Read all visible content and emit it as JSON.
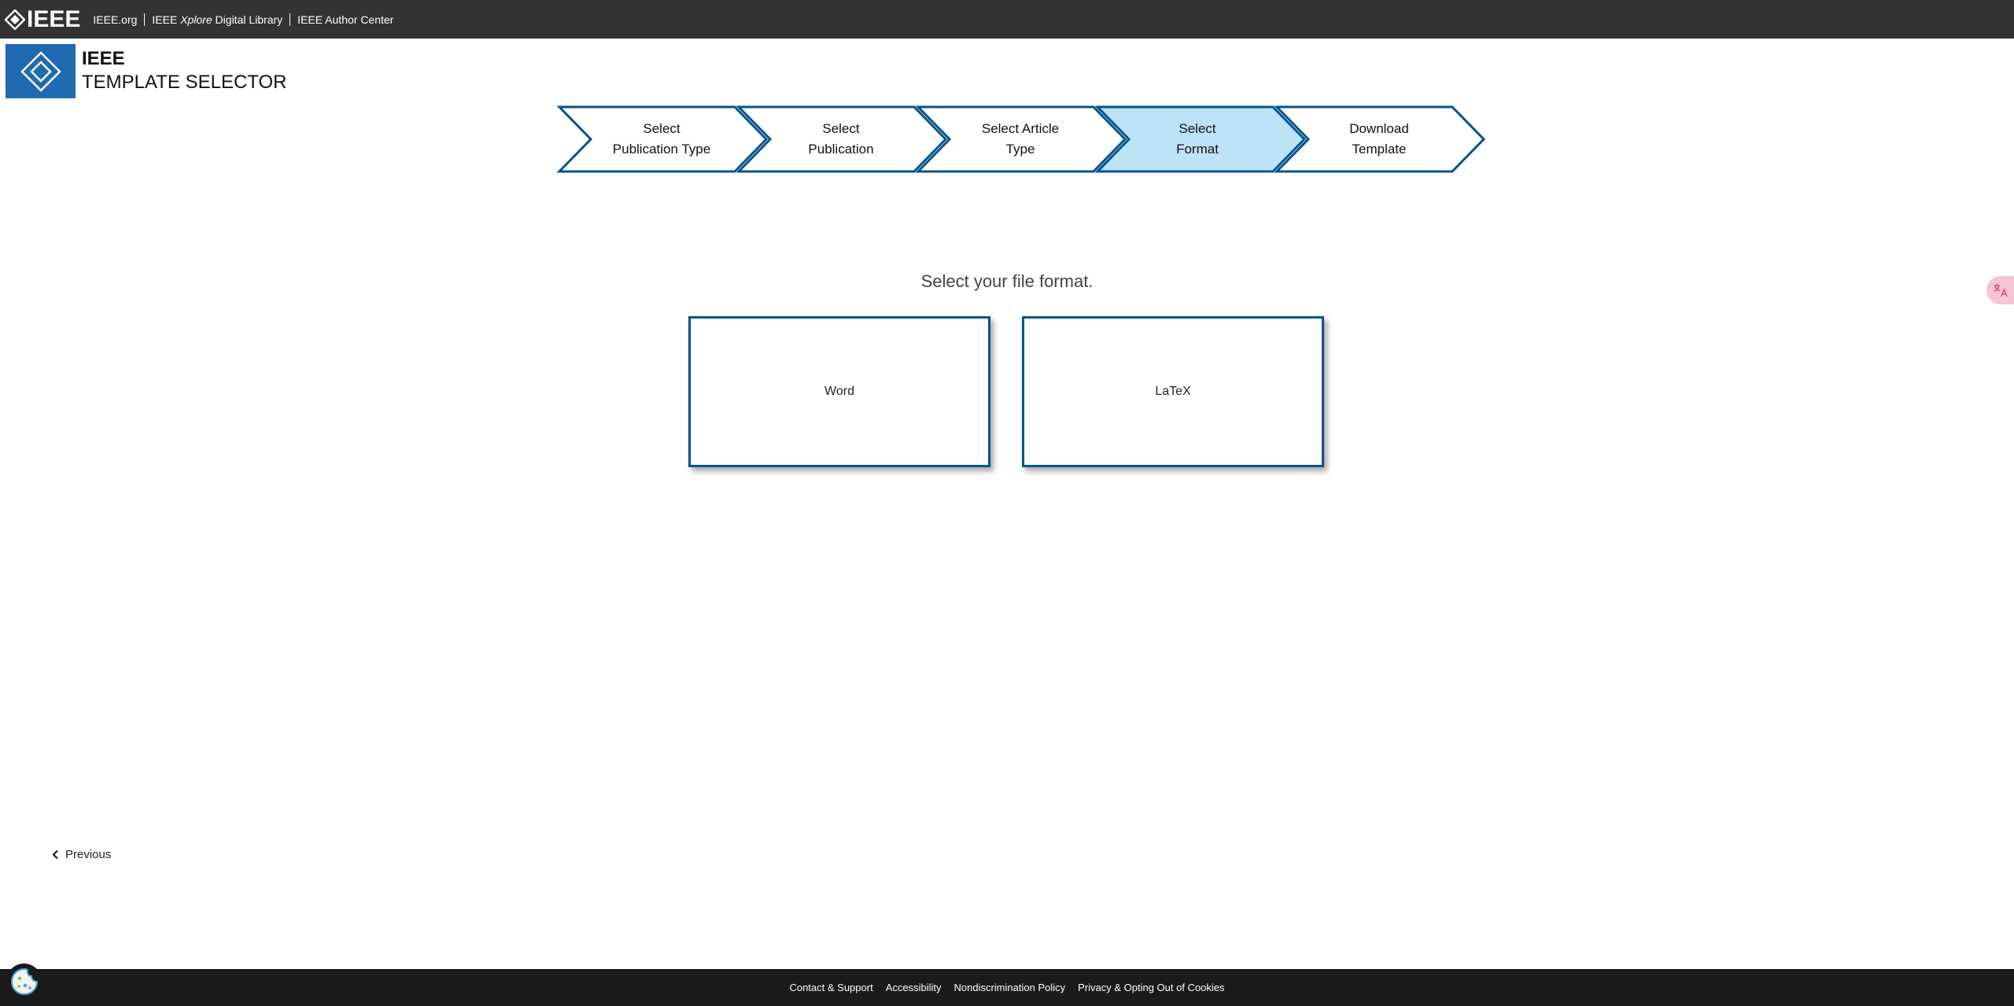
{
  "topbar": {
    "brand": "IEEE",
    "links": [
      {
        "label": "IEEE.org"
      },
      {
        "label_prefix": "IEEE ",
        "label_italic": "Xplore",
        "label_suffix": " Digital Library"
      },
      {
        "label": "IEEE Author Center"
      }
    ]
  },
  "header": {
    "title": "IEEE",
    "subtitle": "TEMPLATE SELECTOR"
  },
  "steps": [
    {
      "label": "Select\nPublication Type",
      "active": false
    },
    {
      "label": "Select\nPublication",
      "active": false
    },
    {
      "label": "Select Article\nType",
      "active": false
    },
    {
      "label": "Select\nFormat",
      "active": true
    },
    {
      "label": "Download\nTemplate",
      "active": false
    }
  ],
  "main": {
    "prompt": "Select your file format.",
    "options": [
      {
        "label": "Word"
      },
      {
        "label": "LaTeX"
      }
    ]
  },
  "nav": {
    "previous_label": "Previous"
  },
  "translate_badge": {
    "icon": "translate-icon"
  },
  "footer": {
    "links": [
      {
        "label": "Contact & Support"
      },
      {
        "label": "Accessibility"
      },
      {
        "label": "Nondiscrimination Policy"
      },
      {
        "label": "Privacy & Opting Out of Cookies"
      }
    ]
  },
  "colors": {
    "topbar_bg": "#333333",
    "brand_blue": "#1f6ab0",
    "step_border": "#00548f",
    "step_active_fill": "#bde3f7",
    "footer_bg": "#1a1a1a"
  }
}
